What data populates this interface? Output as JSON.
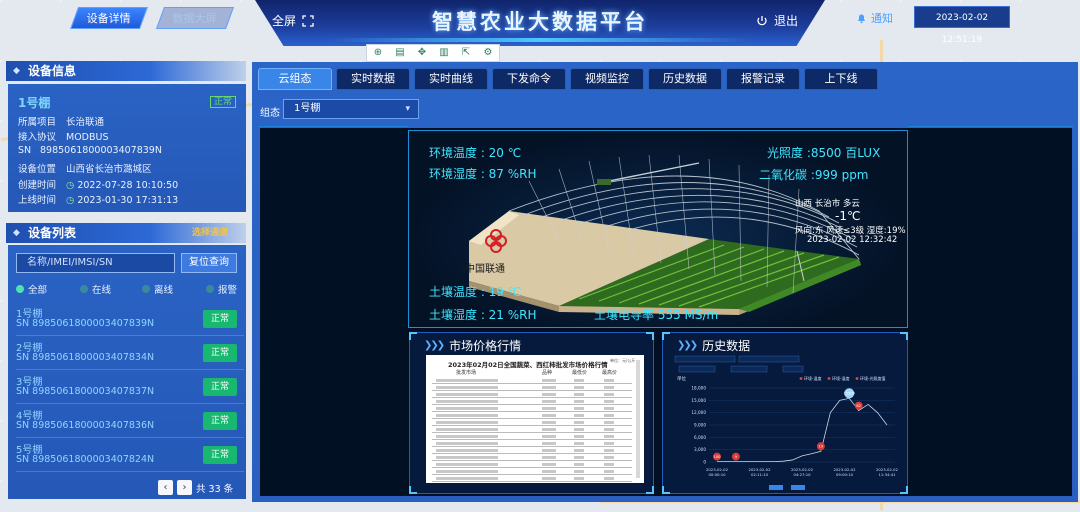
{
  "header": {
    "nav_tabs": [
      "设备详情",
      "数据大屏"
    ],
    "title": "智慧农业大数据平台",
    "fullscreen_label": "全屏",
    "logout_label": "退出",
    "notice_label": "通知",
    "datetime": "2023-02-02 12:51:19"
  },
  "device_info": {
    "heading": "设备信息",
    "name": "1号棚",
    "status": "正常",
    "rows": [
      {
        "key": "所属项目",
        "value": "长治联通"
      },
      {
        "key": "接入协议",
        "value": "MODBUS"
      },
      {
        "key": "SN",
        "value": "8985061800003407839N"
      },
      {
        "key": "设备位置",
        "value": "山西省长治市潞城区"
      },
      {
        "key": "创建时间",
        "value": "2022-07-28 10:10:50"
      },
      {
        "key": "上线时间",
        "value": "2023-01-30 17:31:13"
      }
    ]
  },
  "device_list": {
    "heading": "设备列表",
    "heading_badge": "选择通道",
    "search_placeholder": "名称/IMEI/IMSI/SN",
    "reset_label": "复位查询",
    "filters": [
      {
        "label": "全部",
        "checked": true
      },
      {
        "label": "在线",
        "checked": false
      },
      {
        "label": "离线",
        "checked": false
      },
      {
        "label": "报警",
        "checked": false
      }
    ],
    "items": [
      {
        "name": "1号棚",
        "sn": "SN 8985061800003407839N",
        "status": "正常"
      },
      {
        "name": "2号棚",
        "sn": "SN 8985061800003407834N",
        "status": "正常"
      },
      {
        "name": "3号棚",
        "sn": "SN 8985061800003407837N",
        "status": "正常"
      },
      {
        "name": "4号棚",
        "sn": "SN 8985061800003407836N",
        "status": "正常"
      },
      {
        "name": "5号棚",
        "sn": "SN 8985061800003407824N",
        "status": "正常"
      }
    ],
    "total_label": "共 33 条"
  },
  "tabs": [
    "云组态",
    "实时数据",
    "实时曲线",
    "下发命令",
    "视频监控",
    "历史数据",
    "报警记录",
    "上下线"
  ],
  "group": {
    "label": "组态",
    "selected": "1号棚"
  },
  "scene": {
    "brand": "中国联通",
    "readings": {
      "air_temp": "环境温度 : 20 ℃",
      "air_humidity": "环境湿度 : 87 %RH",
      "light": "光照度 :8500 百LUX",
      "co2": "二氧化碳 :999 ppm",
      "soil_temp": "土壤温度 : 19 ℃",
      "soil_humidity": "土壤湿度 : 21 %RH",
      "soil_ec": "土壤电导率 555 MS/m"
    },
    "weather": {
      "location": "山西 长治市 多云",
      "temp": "-1℃",
      "detail": "风向:东 风速≤3级 湿度:19%",
      "time": "2023-02-02 12:32:42"
    }
  },
  "market_panel": {
    "title": "市场价格行情",
    "doc_title": "2023年02月02日全国蔬菜、西红柿批发市场价格行情",
    "doc_unit": "单位：元/公斤",
    "headers": [
      "批发市场",
      "品种",
      "最低价",
      "最高价"
    ]
  },
  "history_panel": {
    "title": "历史数据",
    "legend": [
      "环境-温度",
      "环境-湿度",
      "环境-光照度值"
    ],
    "y_unit": "单位",
    "chart_data": {
      "type": "line",
      "x": [
        "2023-02-02 00:00:10",
        "2023-02-02 02:11:10",
        "2023-02-02 04:27:10",
        "2023-02-02 09:00:10",
        "2023-02-02 11:34:41"
      ],
      "yticks": [
        "18,000",
        "15,000",
        "12,000",
        "9,000",
        "6,000",
        "3,000",
        "0"
      ],
      "ylim": [
        0,
        18000
      ],
      "series": [
        {
          "name": "环境-光照度值",
          "values": [
            100,
            100,
            100,
            100,
            100,
            100,
            100,
            200,
            500,
            1500,
            2000,
            2600,
            12000,
            15000,
            15500,
            12500,
            14000,
            12000,
            9000
          ]
        }
      ],
      "markers": [
        {
          "label": "100",
          "series": 0,
          "index": 0
        },
        {
          "label": "15500",
          "series": 0,
          "index": 14
        },
        {
          "label": "19",
          "series": 0,
          "index": 11
        },
        {
          "label": "82",
          "series": 0,
          "index": 15
        },
        {
          "label": "9",
          "series": 0,
          "index": 2
        }
      ]
    }
  },
  "colors": {
    "accent": "#3a86e8",
    "reading_cyan": "#3fe6ff",
    "status_green": "#19b870",
    "panel_dark": "#061a3d"
  }
}
